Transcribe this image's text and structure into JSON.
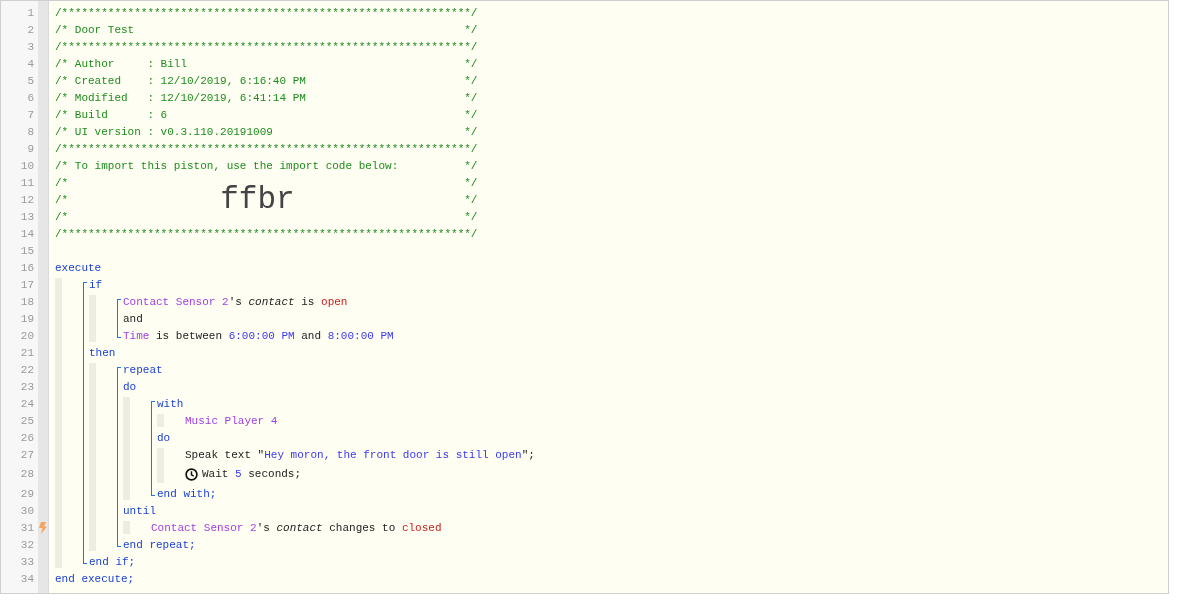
{
  "header_lines": [
    {
      "number": "1",
      "text": "/**************************************************************/"
    },
    {
      "number": "2",
      "text": "/* Door Test",
      "end": "*/"
    },
    {
      "number": "3",
      "text": "/**************************************************************/"
    },
    {
      "number": "4",
      "text": "/* Author     : Bill",
      "end": "*/"
    },
    {
      "number": "5",
      "text": "/* Created    : 12/10/2019, 6:16:40 PM",
      "end": "*/"
    },
    {
      "number": "6",
      "text": "/* Modified   : 12/10/2019, 6:41:14 PM",
      "end": "*/"
    },
    {
      "number": "7",
      "text": "/* Build      : 6",
      "end": "*/"
    },
    {
      "number": "8",
      "text": "/* UI version : v0.3.110.20191009",
      "end": "*/"
    },
    {
      "number": "9",
      "text": "/**************************************************************/"
    },
    {
      "number": "10",
      "text": "/* To import this piston, use the import code below:",
      "end": "*/"
    },
    {
      "number": "11",
      "text": "/*",
      "end": "*/"
    },
    {
      "number": "12",
      "text": "/*",
      "code": "ffbr",
      "end": "*/"
    },
    {
      "number": "13",
      "text": "/*",
      "end": "*/"
    },
    {
      "number": "14",
      "text": "/**************************************************************/"
    },
    {
      "number": "15"
    }
  ],
  "code": [
    {
      "kind": "line",
      "number": "16",
      "tokens": [
        {
          "text": "execute",
          "kind": "keyword"
        }
      ]
    },
    {
      "kind": "indent",
      "children": [
        {
          "kind": "bracket",
          "children": [
            {
              "kind": "line",
              "number": "17",
              "tokens": [
                {
                  "text": "if",
                  "kind": "keyword"
                }
              ]
            },
            {
              "kind": "indent",
              "children": [
                {
                  "kind": "bracket",
                  "children": [
                    {
                      "kind": "line",
                      "number": "18",
                      "tokens": [
                        {
                          "text": "Contact Sensor 2",
                          "kind": "device"
                        },
                        {
                          "text": "'s ",
                          "kind": "plain"
                        },
                        {
                          "text": "contact",
                          "kind": "attribute"
                        },
                        {
                          "text": " is ",
                          "kind": "plain"
                        },
                        {
                          "text": "open",
                          "kind": "value"
                        }
                      ]
                    },
                    {
                      "kind": "line",
                      "number": "19",
                      "tokens": [
                        {
                          "text": "and",
                          "kind": "plain"
                        }
                      ]
                    },
                    {
                      "kind": "line",
                      "number": "20",
                      "tokens": [
                        {
                          "text": "Time",
                          "kind": "device"
                        },
                        {
                          "text": " is between ",
                          "kind": "plain"
                        },
                        {
                          "text": "6:00:00 PM",
                          "kind": "literal"
                        },
                        {
                          "text": " and ",
                          "kind": "plain"
                        },
                        {
                          "text": "8:00:00 PM",
                          "kind": "literal"
                        }
                      ]
                    }
                  ]
                }
              ]
            },
            {
              "kind": "line",
              "number": "21",
              "tokens": [
                {
                  "text": "then",
                  "kind": "keyword"
                }
              ]
            },
            {
              "kind": "indent",
              "children": [
                {
                  "kind": "bracket",
                  "children": [
                    {
                      "kind": "line",
                      "number": "22",
                      "tokens": [
                        {
                          "text": "repeat",
                          "kind": "keyword"
                        }
                      ]
                    },
                    {
                      "kind": "line",
                      "number": "23",
                      "tokens": [
                        {
                          "text": "do",
                          "kind": "keyword"
                        }
                      ]
                    },
                    {
                      "kind": "indent",
                      "children": [
                        {
                          "kind": "bracket",
                          "children": [
                            {
                              "kind": "line",
                              "number": "24",
                              "tokens": [
                                {
                                  "text": "with",
                                  "kind": "keyword"
                                }
                              ]
                            },
                            {
                              "kind": "indent",
                              "children": [
                                {
                                  "kind": "line",
                                  "number": "25",
                                  "tokens": [
                                    {
                                      "text": "Music Player 4",
                                      "kind": "device"
                                    }
                                  ]
                                }
                              ]
                            },
                            {
                              "kind": "line",
                              "number": "26",
                              "tokens": [
                                {
                                  "text": "do",
                                  "kind": "keyword"
                                }
                              ]
                            },
                            {
                              "kind": "indent",
                              "children": [
                                {
                                  "kind": "line",
                                  "number": "27",
                                  "tokens": [
                                    {
                                      "text": "Speak text \"",
                                      "kind": "plain"
                                    },
                                    {
                                      "text": "Hey moron, the front door is still open",
                                      "kind": "literal"
                                    },
                                    {
                                      "text": "\";",
                                      "kind": "plain"
                                    }
                                  ]
                                },
                                {
                                  "kind": "line",
                                  "number": "28",
                                  "wait": true,
                                  "tokens": [
                                    {
                                      "text": "Wait ",
                                      "kind": "plain"
                                    },
                                    {
                                      "text": "5",
                                      "kind": "literal"
                                    },
                                    {
                                      "text": " seconds;",
                                      "kind": "plain"
                                    }
                                  ]
                                }
                              ]
                            },
                            {
                              "kind": "line",
                              "number": "29",
                              "tokens": [
                                {
                                  "text": "end with;",
                                  "kind": "keyword"
                                }
                              ]
                            }
                          ]
                        }
                      ]
                    },
                    {
                      "kind": "line",
                      "number": "30",
                      "tokens": [
                        {
                          "text": "until",
                          "kind": "keyword"
                        }
                      ]
                    },
                    {
                      "kind": "indent",
                      "children": [
                        {
                          "kind": "line",
                          "number": "31",
                          "trigger": true,
                          "tokens": [
                            {
                              "text": "Contact Sensor 2",
                              "kind": "device"
                            },
                            {
                              "text": "'s ",
                              "kind": "plain"
                            },
                            {
                              "text": "contact",
                              "kind": "attribute"
                            },
                            {
                              "text": " changes to ",
                              "kind": "plain"
                            },
                            {
                              "text": "closed",
                              "kind": "value"
                            }
                          ]
                        }
                      ]
                    },
                    {
                      "kind": "line",
                      "number": "32",
                      "tokens": [
                        {
                          "text": "end repeat;",
                          "kind": "keyword"
                        }
                      ]
                    }
                  ]
                }
              ]
            },
            {
              "kind": "line",
              "number": "33",
              "tokens": [
                {
                  "text": "end if;",
                  "kind": "keyword"
                }
              ]
            }
          ]
        }
      ]
    },
    {
      "kind": "line",
      "number": "34",
      "tokens": [
        {
          "text": "end execute;",
          "kind": "keyword"
        }
      ]
    }
  ]
}
